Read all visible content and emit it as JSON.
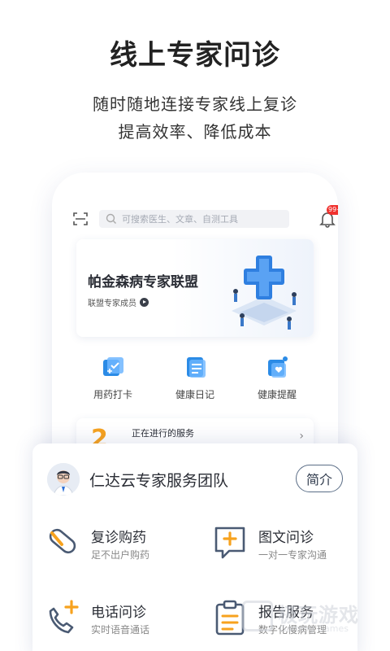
{
  "hero": {
    "title": "线上专家问诊",
    "subtitle_line1": "随时随地连接专家线上复诊",
    "subtitle_line2": "提高效率、降低成本"
  },
  "phone": {
    "search_placeholder": "可搜索医生、文章、自测工具",
    "notification_badge": "99+",
    "banner": {
      "title": "帕金森病专家联盟",
      "link": "联盟专家成员"
    },
    "quick_actions": [
      {
        "label": "用药打卡",
        "icon": "medicine-checkin-icon"
      },
      {
        "label": "健康日记",
        "icon": "health-diary-icon"
      },
      {
        "label": "健康提醒",
        "icon": "health-reminder-icon"
      }
    ],
    "service": {
      "count": "2",
      "title": "正在进行的服务"
    }
  },
  "team_card": {
    "name": "仁达云专家服务团队",
    "intro_button": "简介",
    "features": [
      {
        "title": "复诊购药",
        "subtitle": "足不出户购药",
        "icon": "pill-icon"
      },
      {
        "title": "图文问诊",
        "subtitle": "一对一专家沟通",
        "icon": "chat-plus-icon"
      },
      {
        "title": "电话问诊",
        "subtitle": "实时语音通话",
        "icon": "phone-plus-icon"
      },
      {
        "title": "报告服务",
        "subtitle": "数字化慢病管理",
        "icon": "clipboard-icon"
      }
    ]
  },
  "watermark": {
    "text": "极玩游戏",
    "sub": "Gaming Games"
  },
  "colors": {
    "accent_orange": "#f7a21e",
    "icon_blue": "#2b8be6",
    "outline_dark": "#4a5a73",
    "badge_red": "#f0312e"
  }
}
